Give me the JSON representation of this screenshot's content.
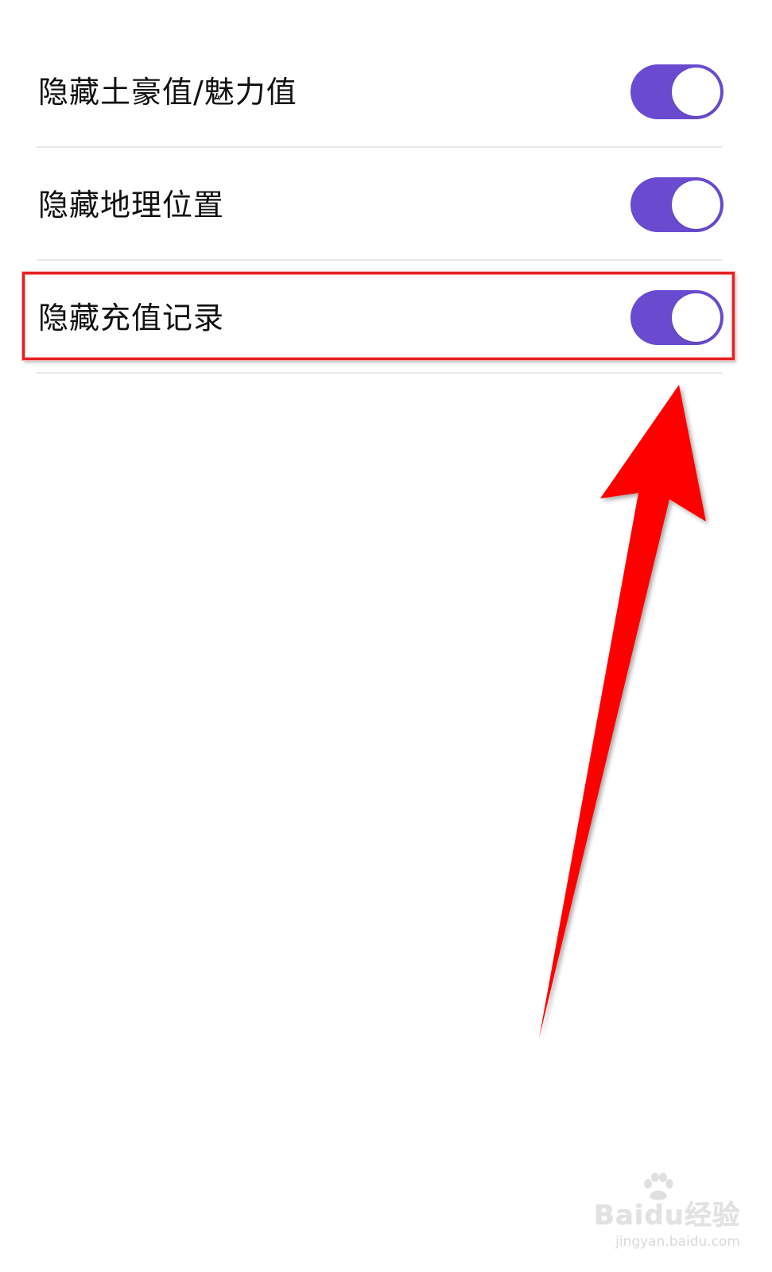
{
  "settings": [
    {
      "label": "隐藏土豪值/魅力值",
      "enabled": true
    },
    {
      "label": "隐藏地理位置",
      "enabled": true
    },
    {
      "label": "隐藏充值记录",
      "enabled": true
    }
  ],
  "annotation": {
    "highlight_color": "#e32222",
    "arrow_color": "#ff0000",
    "highlighted_item": "隐藏充值记录"
  },
  "toggle_color": "#6a4bd0",
  "watermark": {
    "logo": "Baidu经验",
    "url": "jingyan.baidu.com"
  }
}
